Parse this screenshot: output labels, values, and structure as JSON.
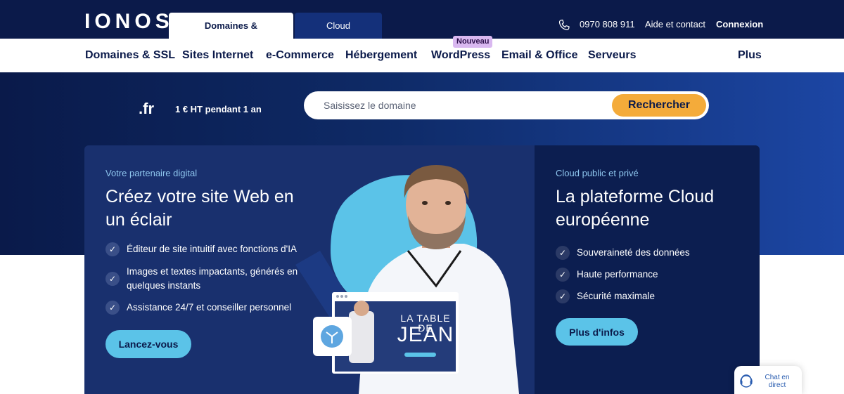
{
  "header": {
    "logo": "IONOS",
    "tabs": [
      {
        "label": "Domaines & Hébergement",
        "active": true
      },
      {
        "label": "Cloud computing",
        "active": false
      }
    ],
    "phone": "0970 808 911",
    "help_link": "Aide et contact",
    "login_link": "Connexion"
  },
  "nav": {
    "items": [
      {
        "label": "Domaines & SSL"
      },
      {
        "label": "Sites Internet"
      },
      {
        "label": "e-Commerce"
      },
      {
        "label": "Hébergement"
      },
      {
        "label": "WordPress",
        "badge": "Nouveau"
      },
      {
        "label": "Email & Office"
      },
      {
        "label": "Serveurs"
      }
    ],
    "more": "Plus"
  },
  "domain_search": {
    "tld": ".fr",
    "offer": "1 € HT pendant 1 an",
    "placeholder": "Saisissez le domaine",
    "button": "Rechercher"
  },
  "left_card": {
    "eyebrow": "Votre partenaire digital",
    "title": "Créez votre site Web en un éclair",
    "features": [
      "Éditeur de site intuitif avec fonctions d'IA",
      "Images et textes impactants, générés en quelques instants",
      "Assistance 24/7 et conseiller personnel"
    ],
    "cta": "Lancez-vous",
    "preview_title_line1": "LA TABLE DE",
    "preview_title_line2": "JEAN"
  },
  "right_card": {
    "eyebrow": "Cloud public et privé",
    "title": "La plateforme Cloud européenne",
    "features": [
      "Souveraineté des données",
      "Haute performance",
      "Sécurité maximale"
    ],
    "cta": "Plus d'infos"
  },
  "chat": {
    "label": "Chat en direct"
  },
  "colors": {
    "navy": "#0b1a4a",
    "accent_orange": "#f4ab3a",
    "accent_cyan": "#5bc3e8",
    "badge_purple": "#d9b8f0"
  }
}
